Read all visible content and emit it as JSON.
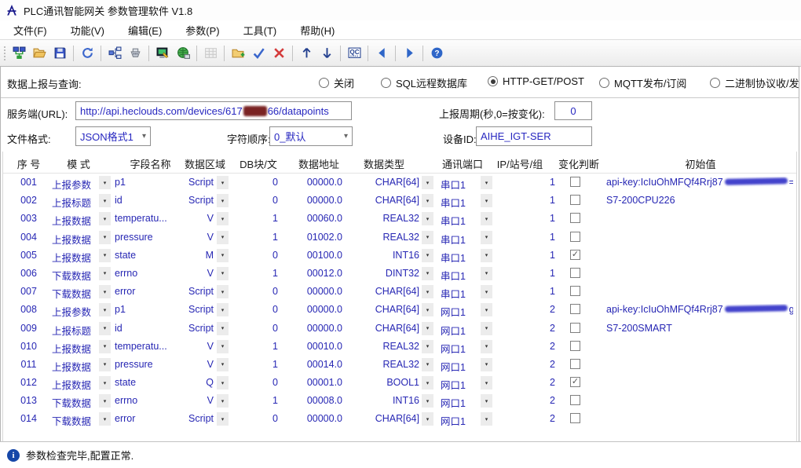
{
  "window": {
    "title": "PLC通讯智能网关 参数管理软件 V1.8"
  },
  "menu": {
    "items": [
      "文件(F)",
      "功能(V)",
      "编辑(E)",
      "参数(P)",
      "工具(T)",
      "帮助(H)"
    ]
  },
  "toolbar": {
    "items": [
      {
        "name": "connect-icon"
      },
      {
        "name": "open-icon"
      },
      {
        "name": "save-icon",
        "sep_after": true
      },
      {
        "name": "refresh-icon",
        "sep_after": true
      },
      {
        "name": "topology-icon"
      },
      {
        "name": "serial-port-icon",
        "sep_after": true
      },
      {
        "name": "monitor-edit-icon"
      },
      {
        "name": "network-globe-icon",
        "sep_after": true
      },
      {
        "name": "table-icon",
        "disabled": true,
        "sep_after": true
      },
      {
        "name": "folder-add-icon"
      },
      {
        "name": "check-icon"
      },
      {
        "name": "cancel-icon",
        "sep_after": true
      },
      {
        "name": "move-up-icon"
      },
      {
        "name": "move-down-icon",
        "sep_after": true
      },
      {
        "name": "qc-icon",
        "sep_after": true
      },
      {
        "name": "prev-icon",
        "sep_after": true
      },
      {
        "name": "next-icon",
        "sep_after": true
      },
      {
        "name": "help-icon"
      }
    ]
  },
  "report": {
    "label": "数据上报与查询:",
    "options": [
      {
        "label": "关闭",
        "selected": false
      },
      {
        "label": "SQL远程数据库",
        "selected": false
      },
      {
        "label": "HTTP-GET/POST",
        "selected": true
      },
      {
        "label": "MQTT发布/订阅",
        "selected": false
      },
      {
        "label": "二进制协议收/发",
        "selected": false
      }
    ]
  },
  "settings": {
    "url_label": "服务端(URL):",
    "url_value_prefix": "http://api.heclouds.com/devices/617",
    "url_redacted": true,
    "url_value_suffix": "66/datapoints",
    "period_label": "上报周期(秒,0=按变化):",
    "period_value": "0",
    "format_label": "文件格式:",
    "format_value": "JSON格式1",
    "order_label": "字符顺序:",
    "order_value": "0_默认",
    "device_label": "设备ID:",
    "device_value": "AIHE_IGT-SER"
  },
  "table": {
    "headers": [
      "序 号",
      "模 式",
      "字段名称",
      "数据区域",
      "DB块/文",
      "数据地址",
      "数据类型",
      "通讯端口",
      "IP/站号/组",
      "变化判断",
      "初始值"
    ],
    "rows": [
      {
        "seq": "001",
        "mode": "上报参数",
        "field": "p1",
        "area": "Script",
        "db": "0",
        "addr": "00000.0",
        "type": "CHAR[64]",
        "port": "串口1",
        "ip": "1",
        "changed": false,
        "init": "api-key:IcIuOhMFQf4Rrj87",
        "init_redacted": true,
        "init_suffix": "="
      },
      {
        "seq": "002",
        "mode": "上报标题",
        "field": "id",
        "area": "Script",
        "db": "0",
        "addr": "00000.0",
        "type": "CHAR[64]",
        "port": "串口1",
        "ip": "1",
        "changed": false,
        "init": "S7-200CPU226"
      },
      {
        "seq": "003",
        "mode": "上报数据",
        "field": "temperatu...",
        "area": "V",
        "db": "1",
        "addr": "00060.0",
        "type": "REAL32",
        "port": "串口1",
        "ip": "1",
        "changed": false,
        "init": ""
      },
      {
        "seq": "004",
        "mode": "上报数据",
        "field": "pressure",
        "area": "V",
        "db": "1",
        "addr": "01002.0",
        "type": "REAL32",
        "port": "串口1",
        "ip": "1",
        "changed": false,
        "init": ""
      },
      {
        "seq": "005",
        "mode": "上报数据",
        "field": "state",
        "area": "M",
        "db": "0",
        "addr": "00100.0",
        "type": "INT16",
        "port": "串口1",
        "ip": "1",
        "changed": true,
        "init": ""
      },
      {
        "seq": "006",
        "mode": "下载数据",
        "field": "errno",
        "area": "V",
        "db": "1",
        "addr": "00012.0",
        "type": "DINT32",
        "port": "串口1",
        "ip": "1",
        "changed": false,
        "init": ""
      },
      {
        "seq": "007",
        "mode": "下载数据",
        "field": "error",
        "area": "Script",
        "db": "0",
        "addr": "00000.0",
        "type": "CHAR[64]",
        "port": "串口1",
        "ip": "1",
        "changed": false,
        "init": ""
      },
      {
        "seq": "008",
        "mode": "上报参数",
        "field": "p1",
        "area": "Script",
        "db": "0",
        "addr": "00000.0",
        "type": "CHAR[64]",
        "port": "网口1",
        "ip": "2",
        "changed": false,
        "init": "api-key:IcIuOhMFQf4Rrj87",
        "init_redacted": true,
        "init_suffix": "g="
      },
      {
        "seq": "009",
        "mode": "上报标题",
        "field": "id",
        "area": "Script",
        "db": "0",
        "addr": "00000.0",
        "type": "CHAR[64]",
        "port": "网口1",
        "ip": "2",
        "changed": false,
        "init": "S7-200SMART"
      },
      {
        "seq": "010",
        "mode": "上报数据",
        "field": "temperatu...",
        "area": "V",
        "db": "1",
        "addr": "00010.0",
        "type": "REAL32",
        "port": "网口1",
        "ip": "2",
        "changed": false,
        "init": ""
      },
      {
        "seq": "011",
        "mode": "上报数据",
        "field": "pressure",
        "area": "V",
        "db": "1",
        "addr": "00014.0",
        "type": "REAL32",
        "port": "网口1",
        "ip": "2",
        "changed": false,
        "init": ""
      },
      {
        "seq": "012",
        "mode": "上报数据",
        "field": "state",
        "area": "Q",
        "db": "0",
        "addr": "00001.0",
        "type": "BOOL1",
        "port": "网口1",
        "ip": "2",
        "changed": true,
        "init": ""
      },
      {
        "seq": "013",
        "mode": "下载数据",
        "field": "errno",
        "area": "V",
        "db": "1",
        "addr": "00008.0",
        "type": "INT16",
        "port": "网口1",
        "ip": "2",
        "changed": false,
        "init": ""
      },
      {
        "seq": "014",
        "mode": "下载数据",
        "field": "error",
        "area": "Script",
        "db": "0",
        "addr": "00000.0",
        "type": "CHAR[64]",
        "port": "网口1",
        "ip": "2",
        "changed": false,
        "init": ""
      }
    ]
  },
  "statusbar": {
    "text": "参数检查完毕,配置正常."
  },
  "colors": {
    "table_text_blue": "#2727b4",
    "value_blue": "#2727c0",
    "check_blue": "#3a66cc",
    "cancel_red": "#d43b3b",
    "arrow_navy": "#23408f",
    "redaction_url": "#7a2323",
    "redaction_key": "#4343cc",
    "info_blue": "#1647a8"
  }
}
